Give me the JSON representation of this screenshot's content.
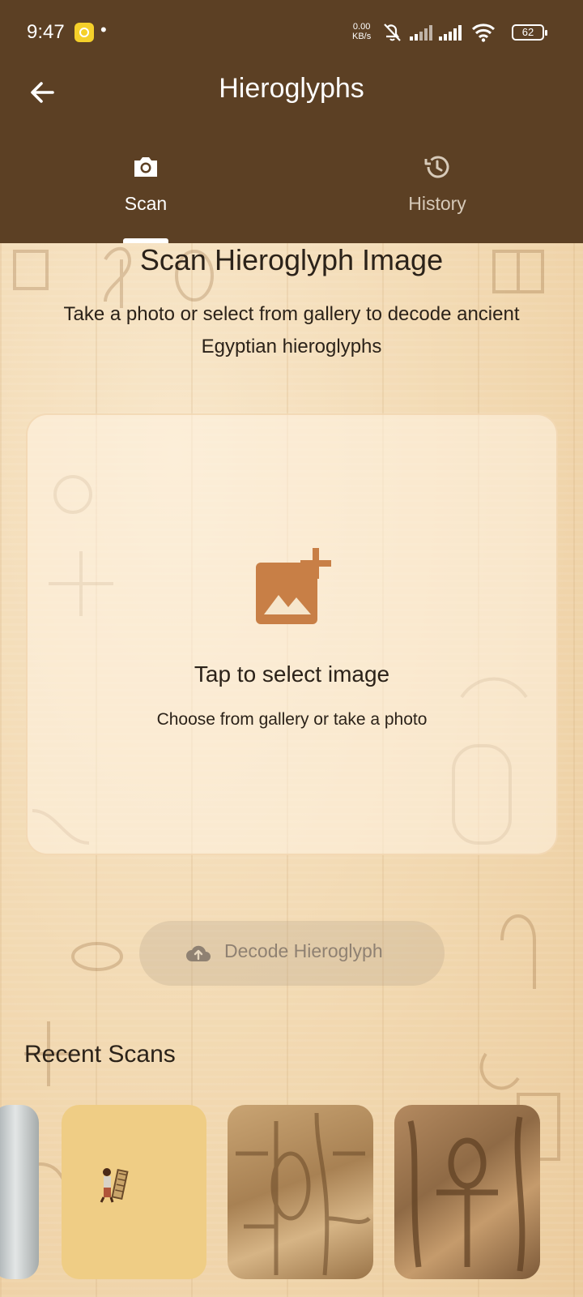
{
  "status_bar": {
    "time": "9:47",
    "dot": "•",
    "speed_value": "0.00",
    "speed_unit": "KB/s",
    "battery": "62",
    "icons": [
      "notification-icon",
      "mute-icon",
      "signal-icon",
      "signal-icon",
      "wifi-icon",
      "battery-icon"
    ]
  },
  "app_bar": {
    "title": "Hieroglyphs",
    "back_icon": "arrow-left-icon"
  },
  "tabs": [
    {
      "label": "Scan",
      "icon": "camera-icon",
      "active": true
    },
    {
      "label": "History",
      "icon": "history-icon",
      "active": false
    }
  ],
  "main": {
    "heading": "Scan Hieroglyph Image",
    "subtitle": "Take a photo or select from gallery to decode ancient Egyptian hieroglyphs",
    "picker": {
      "icon": "add-photo-icon",
      "title": "Tap to select image",
      "subtitle": "Choose from gallery or take a photo"
    },
    "decode_button": {
      "icon": "cloud-upload-icon",
      "label": "Decode Hieroglyph"
    },
    "recent_title": "Recent Scans"
  },
  "colors": {
    "app_bar_bg": "#5c4024",
    "accent_icon": "#c87f46",
    "text_dark": "#2b2219",
    "disabled_text": "#8f8172"
  }
}
